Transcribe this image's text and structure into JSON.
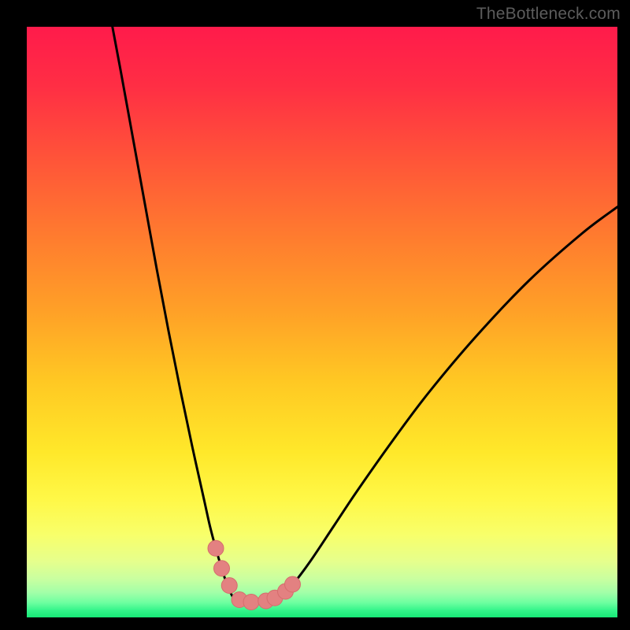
{
  "watermark": "TheBottleneck.com",
  "colors": {
    "frame": "#000000",
    "curve": "#000000",
    "marker_fill": "#e38181",
    "marker_stroke": "#d56c6c",
    "gradient_stops": [
      {
        "offset": 0.0,
        "color": "#ff1b4b"
      },
      {
        "offset": 0.1,
        "color": "#ff2e44"
      },
      {
        "offset": 0.22,
        "color": "#ff5339"
      },
      {
        "offset": 0.35,
        "color": "#ff7a2f"
      },
      {
        "offset": 0.48,
        "color": "#ffa027"
      },
      {
        "offset": 0.6,
        "color": "#ffc823"
      },
      {
        "offset": 0.72,
        "color": "#ffe82a"
      },
      {
        "offset": 0.8,
        "color": "#fff847"
      },
      {
        "offset": 0.86,
        "color": "#f8ff6a"
      },
      {
        "offset": 0.905,
        "color": "#e6ff8c"
      },
      {
        "offset": 0.935,
        "color": "#c9ffa0"
      },
      {
        "offset": 0.958,
        "color": "#a2ffa8"
      },
      {
        "offset": 0.975,
        "color": "#6effa0"
      },
      {
        "offset": 0.988,
        "color": "#34f58a"
      },
      {
        "offset": 1.0,
        "color": "#17e877"
      }
    ]
  },
  "chart_data": {
    "type": "line",
    "title": "",
    "xlabel": "",
    "ylabel": "",
    "xlim": [
      0,
      100
    ],
    "ylim": [
      0,
      100
    ],
    "grid": false,
    "legend": false,
    "series": [
      {
        "name": "left-curve",
        "x": [
          14.5,
          16,
          18,
          20,
          22,
          24,
          26,
          28,
          30,
          31,
          32,
          33,
          34,
          35
        ],
        "y": [
          100,
          92,
          81,
          70,
          59,
          48.5,
          38.5,
          29,
          20,
          15.5,
          11.7,
          8.3,
          5.3,
          3.2
        ]
      },
      {
        "name": "right-curve",
        "x": [
          43,
          45,
          48,
          52,
          56,
          62,
          68,
          76,
          85,
          94,
          100
        ],
        "y": [
          3.3,
          5.5,
          9.5,
          15.5,
          21.5,
          30,
          38,
          47.5,
          57,
          65,
          69.5
        ]
      },
      {
        "name": "valley-markers",
        "x": [
          32.0,
          33.0,
          34.3,
          36.0,
          38.0,
          40.5,
          42.0,
          43.8,
          45.0
        ],
        "y": [
          11.7,
          8.3,
          5.4,
          3.0,
          2.6,
          2.8,
          3.3,
          4.4,
          5.6
        ]
      }
    ],
    "annotations": []
  }
}
